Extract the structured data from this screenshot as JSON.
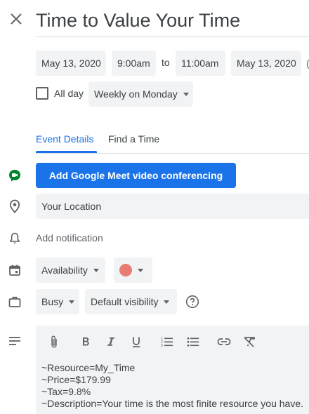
{
  "event": {
    "title": "Time to Value Your Time"
  },
  "datetime": {
    "start_date": "May 13, 2020",
    "start_time": "9:00am",
    "separator": "to",
    "end_time": "11:00am",
    "end_date": "May 13, 2020",
    "all_day_label": "All day",
    "all_day_checked": false,
    "recurrence": "Weekly on Monday"
  },
  "tabs": [
    {
      "label": "Event Details",
      "active": true
    },
    {
      "label": "Find a Time",
      "active": false
    }
  ],
  "conferencing": {
    "button_label": "Add Google Meet video conferencing",
    "icon": "google-meet-icon"
  },
  "location": {
    "value": "Your Location",
    "icon": "location-pin-icon"
  },
  "notification": {
    "label": "Add notification",
    "icon": "bell-icon"
  },
  "calendar": {
    "availability_label": "Availability",
    "event_color": "#e67c73",
    "icon": "calendar-icon"
  },
  "status": {
    "busy_label": "Busy",
    "visibility_label": "Default visibility",
    "icon": "briefcase-icon"
  },
  "description": {
    "icon": "notes-icon",
    "toolbar": [
      "attachment-icon",
      "bold-icon",
      "italic-icon",
      "underline-icon",
      "numbered-list-icon",
      "bulleted-list-icon",
      "link-icon",
      "clear-formatting-icon"
    ],
    "lines": [
      "~Resource=My_Time",
      "~Price=$179.99",
      "~Tax=9.8%",
      "~Description=Your time is the most finite resource you have."
    ]
  },
  "colors": {
    "accent": "#1a73e8",
    "meet_green": "#00832d",
    "chip_bg": "#f1f3f4"
  }
}
